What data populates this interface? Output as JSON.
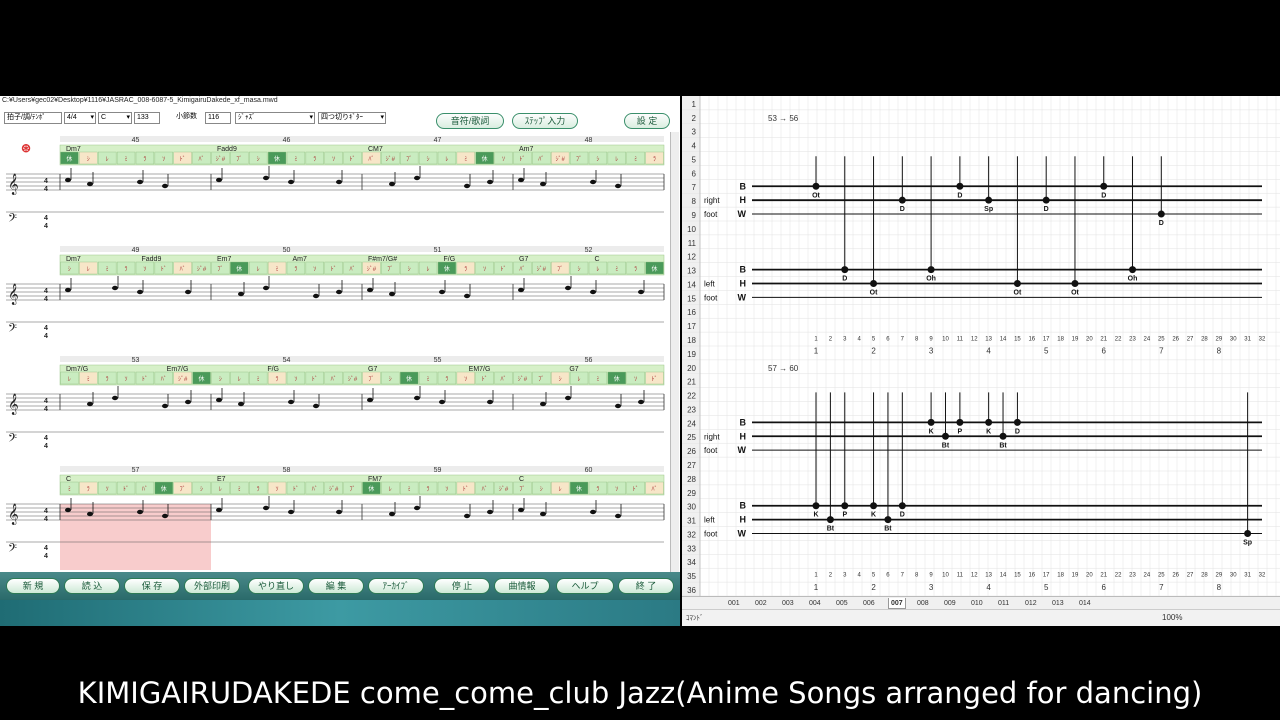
{
  "app": {
    "path": "C:¥Users¥gec02¥Desktop¥1116¥JASRAC_008-6087-5_KimigairuDakede_xf_masa.mwd"
  },
  "toolbar": {
    "time_tempo_label": "拍子/調/ﾃﾝﾎﾟ",
    "time_sig": "4/4",
    "key": "C",
    "tempo": "133",
    "measures_label": "小節数",
    "measures": "116",
    "style": "ｼﾞｬｽﾞ",
    "guitar": "四つ切りｷﾞﾀｰ",
    "lyrics_button": "音符/歌詞",
    "step_input_button": "ｽﾃｯﾌﾟ入力",
    "settings_button": "設 定"
  },
  "bottom_buttons": [
    "新 規",
    "読 込",
    "保 存",
    "外部印刷",
    "やり直し",
    "編 集",
    "ｱｰｶｲﾌﾞ",
    "停 止",
    "曲情報",
    "ヘルプ",
    "終 了"
  ],
  "score": {
    "rows": [
      {
        "measures": [
          "45",
          "46",
          "47",
          "48"
        ],
        "chords": [
          "Dm7",
          "Fadd9",
          "CM7",
          "Am7"
        ],
        "sel": false
      },
      {
        "measures": [
          "49",
          "50",
          "51",
          "52"
        ],
        "chords": [
          "Dm7",
          "Fadd9",
          "Em7",
          "Am7",
          "F#m7/G#",
          "F/G",
          "G7",
          "C"
        ],
        "sel": false
      },
      {
        "measures": [
          "53",
          "54",
          "55",
          "56"
        ],
        "chords": [
          "Dm7/G",
          "Em7/G",
          "F/G",
          "G7",
          "EM7/G",
          "G7"
        ],
        "sel": false
      },
      {
        "measures": [
          "57",
          "58",
          "59",
          "60"
        ],
        "chords": [
          "C",
          "E7",
          "FM7",
          "C"
        ],
        "sel": true
      }
    ],
    "rest_label": "休",
    "syllables": [
      "ﾌﾞ",
      "ｼ",
      "ﾚ",
      "ﾐ",
      "ﾗ",
      "ｿ",
      "ﾄﾞ",
      "ﾊﾞ",
      "ｼﾞ#"
    ]
  },
  "sheet": {
    "row_numbers": [
      "1",
      "2",
      "3",
      "4",
      "5",
      "6",
      "7",
      "8",
      "9",
      "10",
      "11",
      "12",
      "13",
      "14",
      "15",
      "16",
      "17",
      "18",
      "19",
      "20",
      "21",
      "22",
      "23",
      "24",
      "25",
      "26",
      "27",
      "28",
      "29",
      "30",
      "31",
      "32",
      "33",
      "34",
      "35",
      "36"
    ],
    "block1": {
      "title": "53 → 56",
      "lane_letters": [
        "B",
        "H",
        "W",
        "B",
        "H",
        "W"
      ],
      "right_label": "right",
      "left_label": "left",
      "foot_label": "foot",
      "labels": [
        "Ot",
        "D",
        "Ot",
        "D",
        "Oh",
        "D",
        "Sp",
        "Ot",
        "D",
        "Ot",
        "D",
        "Oh",
        "D"
      ],
      "ticks": [
        "1",
        "2",
        "3",
        "4",
        "5",
        "6",
        "7",
        "8",
        "9",
        "10",
        "11",
        "12",
        "13",
        "14",
        "15",
        "16",
        "17",
        "18",
        "19",
        "20",
        "21",
        "22",
        "23",
        "24",
        "25",
        "26",
        "27",
        "28",
        "29",
        "30",
        "31",
        "32"
      ],
      "beats": [
        "1",
        "2",
        "3",
        "4",
        "5",
        "6",
        "7",
        "8"
      ]
    },
    "block2": {
      "title": "57 → 60",
      "lane_letters": [
        "B",
        "H",
        "W",
        "B",
        "H",
        "W"
      ],
      "right_label": "right",
      "left_label": "left",
      "foot_label": "foot",
      "labels": [
        "K",
        "Bt",
        "P",
        "K",
        "Bt",
        "D",
        "K",
        "Bt",
        "P",
        "K",
        "D",
        "Bt",
        "Sp"
      ],
      "ticks": [
        "1",
        "2",
        "3",
        "4",
        "5",
        "6",
        "7",
        "8",
        "9",
        "10",
        "11",
        "12",
        "13",
        "14",
        "15",
        "16",
        "17",
        "18",
        "19",
        "20",
        "21",
        "22",
        "23",
        "24",
        "25",
        "26",
        "27",
        "28",
        "29",
        "30",
        "31",
        "32"
      ],
      "beats": [
        "1",
        "2",
        "3",
        "4",
        "5",
        "6",
        "7",
        "8"
      ]
    },
    "tabs": [
      "001",
      "002",
      "003",
      "004",
      "005",
      "006",
      "007",
      "008",
      "009",
      "010",
      "011",
      "012",
      "013",
      "014"
    ],
    "active_tab": "007",
    "status": "ｺﾏﾝﾄﾞ",
    "zoom": "100%"
  },
  "caption": "KIMIGAIRUDAKEDE come_come_club Jazz(Anime Songs arranged for dancing)"
}
